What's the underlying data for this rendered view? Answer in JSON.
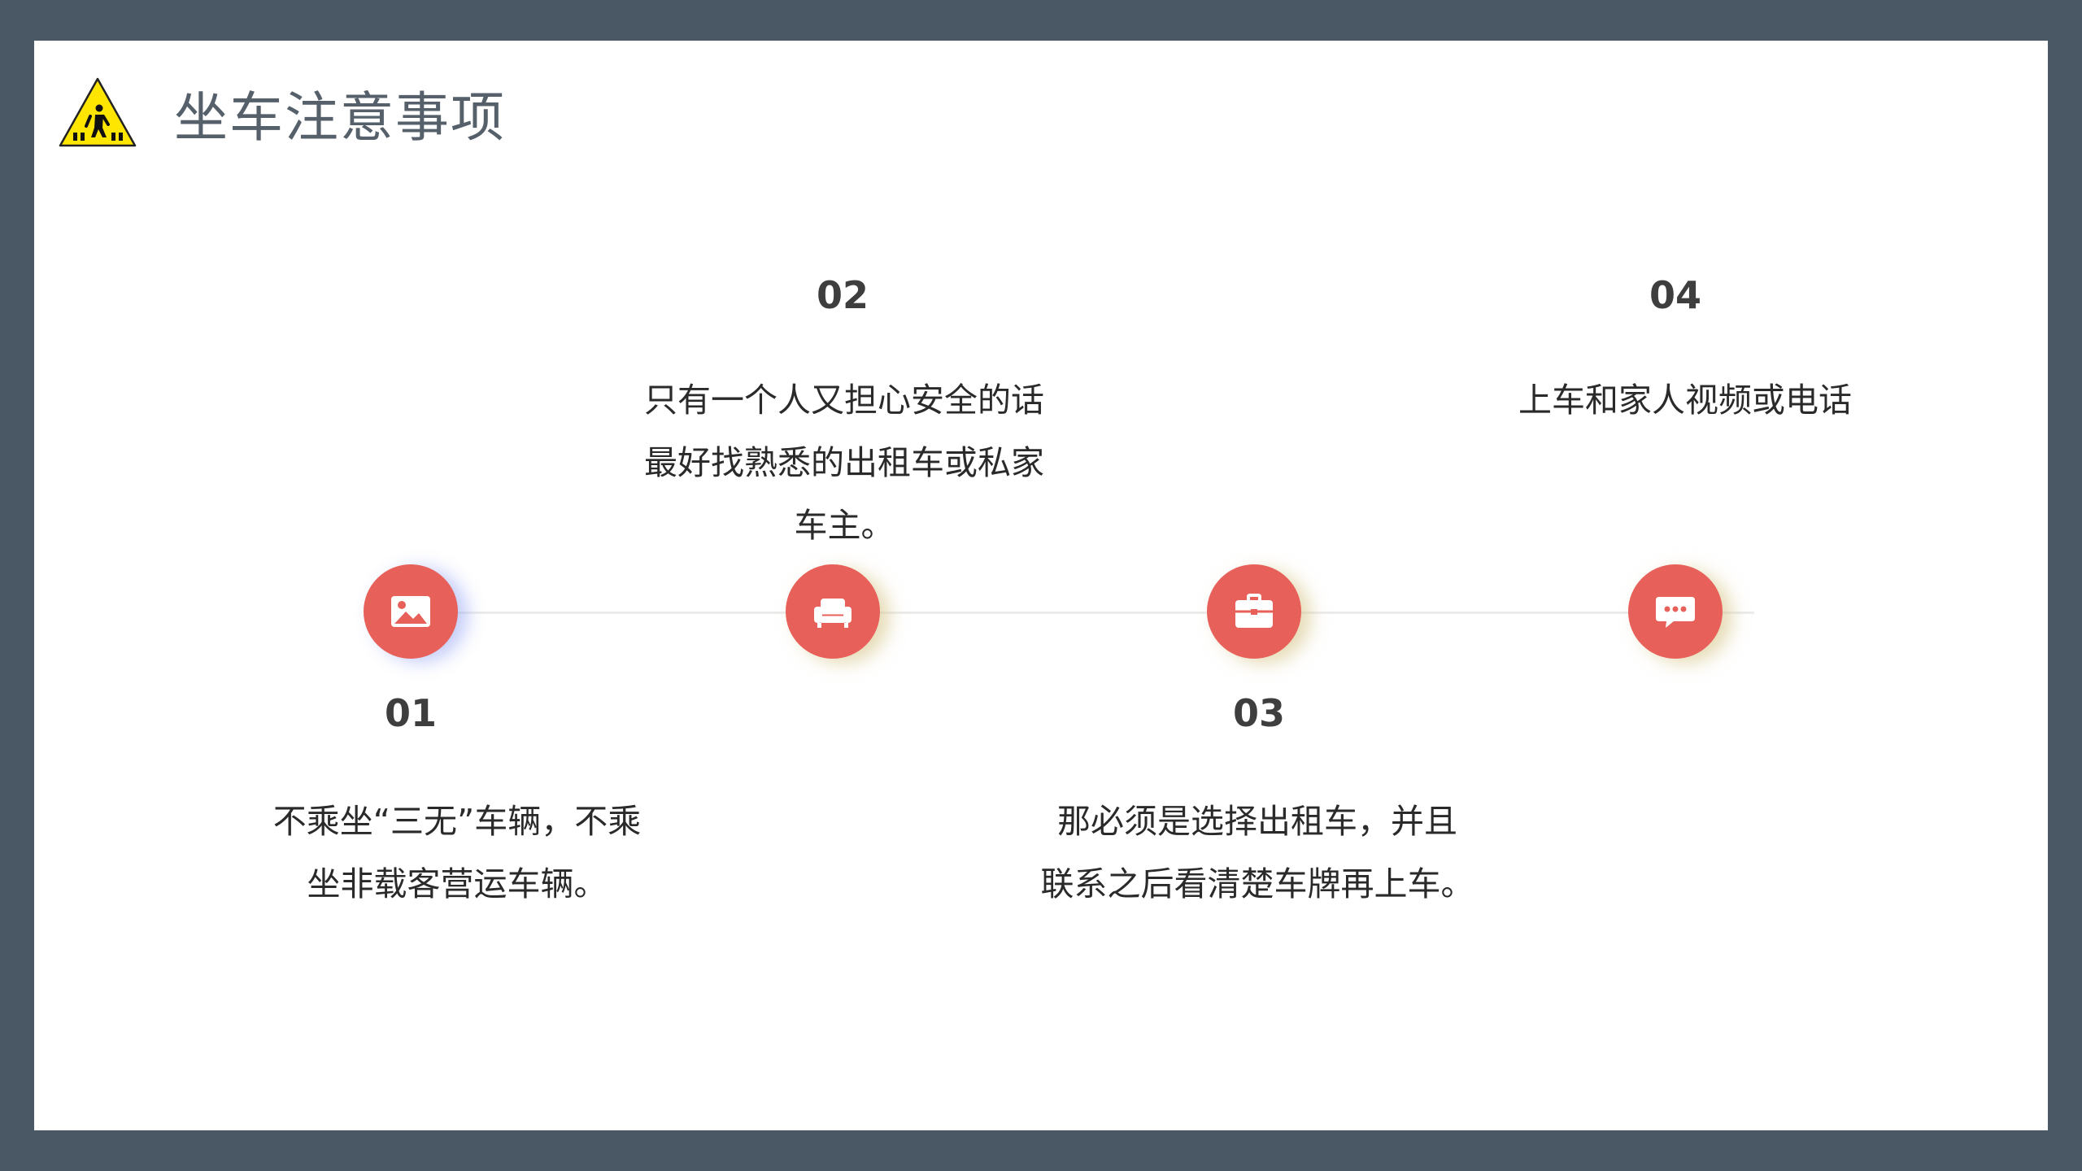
{
  "header": {
    "title": "坐车注意事项",
    "icon": "pedestrian-warning-sign-icon"
  },
  "colors": {
    "frame": "#4a5866",
    "accent": "#e7615a",
    "title": "#56606b",
    "sign_yellow": "#ffe600"
  },
  "steps": [
    {
      "number": "01",
      "lines": [
        "不乘坐“三无”车辆，不乘",
        "坐非载客营运车辆。"
      ],
      "icon": "image-icon"
    },
    {
      "number": "02",
      "lines": [
        "只有一个人又担心安全的话",
        "最好找熟悉的出租车或私家",
        "车主。"
      ],
      "icon": "sofa-icon"
    },
    {
      "number": "03",
      "lines": [
        "那必须是选择出租车，并且",
        "联系之后看清楚车牌再上车。"
      ],
      "icon": "briefcase-icon"
    },
    {
      "number": "04",
      "lines": [
        "上车和家人视频或电话"
      ],
      "icon": "chat-bubble-icon"
    }
  ]
}
